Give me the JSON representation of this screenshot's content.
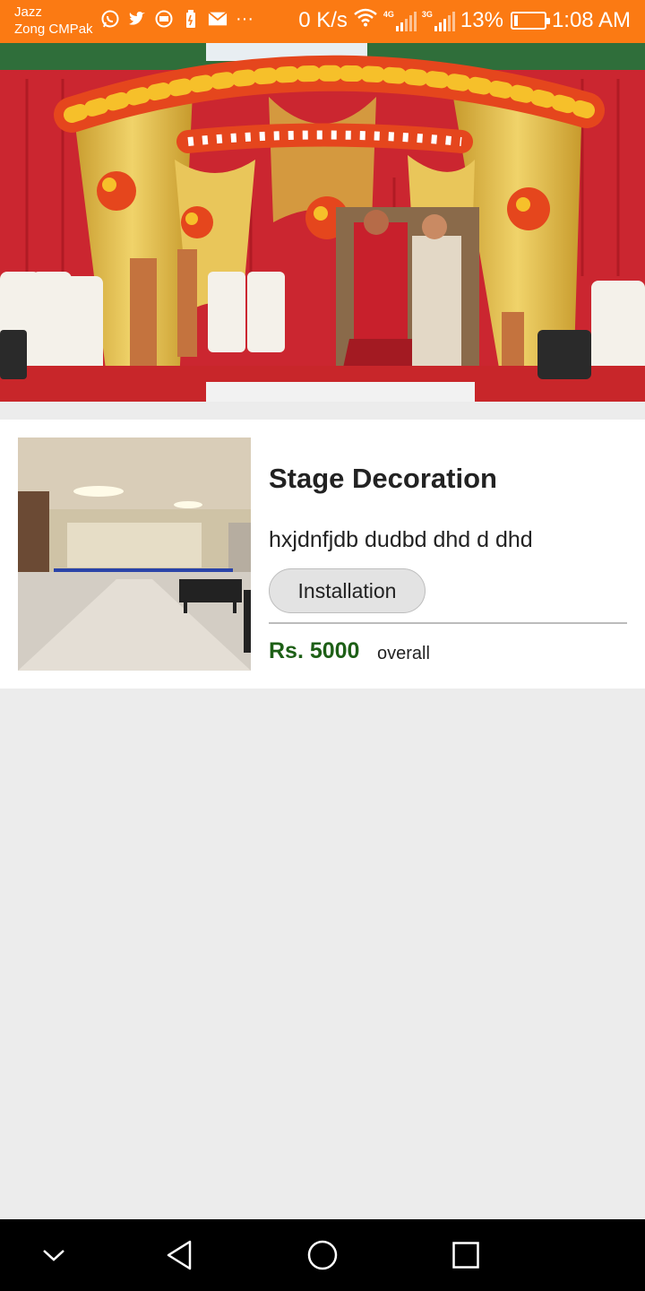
{
  "status_bar": {
    "carrier_1": "Jazz",
    "carrier_2": "Zong CMPak",
    "notification_icons": [
      "whatsapp-icon",
      "twitter-icon",
      "message-icon",
      "battery-saver-icon",
      "mail-icon",
      "more-icon"
    ],
    "overflow": "···",
    "network_speed": "0 K/s",
    "network_1_type": "4G",
    "network_2_type": "3G",
    "battery_level": 13,
    "battery_text": "13%",
    "time": "1:08 AM"
  },
  "hero": {
    "icon": "stage-decoration-photo"
  },
  "card": {
    "title": "Stage Decoration",
    "description": "hxjdnfjdb dudbd dhd d dhd",
    "tag": "Installation",
    "price": "Rs. 5000",
    "price_unit": "overall",
    "thumbnail_icon": "hall-photo"
  },
  "colors": {
    "status_bar": "#fb7a13",
    "price": "#1d5f16",
    "background": "#ececec",
    "nav_bar": "#000000"
  },
  "nav_bar": {
    "icons": [
      "chevron-down-icon",
      "back-icon",
      "home-icon",
      "recents-icon"
    ]
  }
}
